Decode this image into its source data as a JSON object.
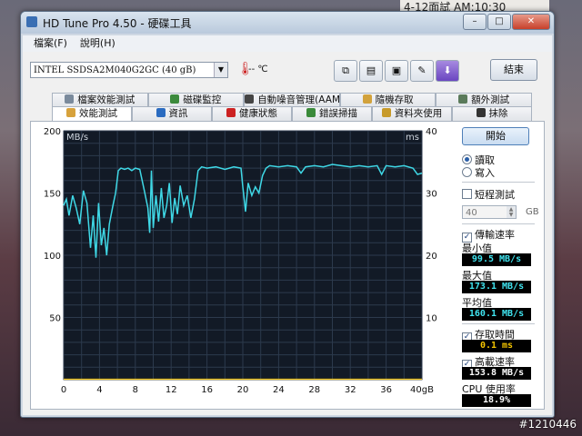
{
  "desktop": {
    "note": "4-12面試 AM:10:30",
    "tag": "#1210446"
  },
  "window": {
    "title": "HD Tune Pro 4.50 - 硬碟工具",
    "min": "–",
    "max": "□",
    "close": "✕"
  },
  "menu": {
    "file": "檔案(F)",
    "help": "說明(H)"
  },
  "toolbar": {
    "drive": "INTEL SSDSA2M040G2GC    (40 gB)",
    "temperature": "-- ℃",
    "exit_label": "結束"
  },
  "tabs": {
    "top": [
      "檔案效能測試",
      "磁碟監控",
      "自動噪音管理(AAM)",
      "隨機存取",
      "額外測試"
    ],
    "bottom": [
      "效能測試",
      "資訊",
      "健康狀態",
      "錯誤掃描",
      "資料夾使用",
      "抹除"
    ],
    "active": "效能測試"
  },
  "controls": {
    "start_label": "開始",
    "read_label": "讀取",
    "write_label": "寫入",
    "short_test_label": "短程測試",
    "short_test_value": "40",
    "short_test_unit": "GB",
    "transfer_label": "傳輸速率",
    "min_label": "最小值",
    "min_value": "99.5 MB/s",
    "max_label": "最大值",
    "max_value": "173.1 MB/s",
    "avg_label": "平均值",
    "avg_value": "160.1 MB/s",
    "access_label": "存取時間",
    "access_value": "0.1 ms",
    "burst_label": "高載速率",
    "burst_value": "153.8 MB/s",
    "cpu_label": "CPU 使用率",
    "cpu_value": "18.9%"
  },
  "chart_data": {
    "type": "line",
    "ylabel": "MB/s",
    "y2label": "ms",
    "xlabel": "gB",
    "xlim": [
      0,
      40
    ],
    "ylim": [
      0,
      200
    ],
    "y2lim": [
      0,
      40
    ],
    "x_ticks": [
      "0",
      "4",
      "8",
      "12",
      "16",
      "20",
      "24",
      "28",
      "32",
      "36",
      "40gB"
    ],
    "y_ticks": [
      "200",
      "150",
      "100",
      "50"
    ],
    "y2_ticks": [
      "40",
      "30",
      "20",
      "10"
    ],
    "series": [
      {
        "color": "#3fd8e6",
        "x": [
          0,
          0.3,
          0.6,
          1,
          1.4,
          1.8,
          2.2,
          2.6,
          3,
          3.3,
          3.6,
          3.9,
          4.2,
          4.5,
          4.8,
          5.1,
          5.5,
          5.8,
          6.1,
          6.4,
          6.8,
          7.2,
          7.6,
          8,
          8.5,
          9,
          9.4,
          9.6,
          9.8,
          10,
          10.3,
          10.6,
          10.9,
          11.2,
          11.5,
          11.8,
          12.1,
          12.4,
          12.7,
          13,
          13.4,
          13.8,
          14.2,
          14.6,
          15,
          15.4,
          16,
          17,
          18,
          19,
          19.8,
          20,
          20.3,
          20.6,
          21,
          21.4,
          21.8,
          22.2,
          22.6,
          23,
          24,
          25,
          26,
          26.5,
          27,
          28,
          29,
          30,
          31,
          32,
          33,
          34,
          35,
          35.5,
          36,
          37,
          38,
          39,
          39.5,
          40
        ],
        "y": [
          140,
          145,
          132,
          148,
          138,
          125,
          152,
          142,
          106,
          132,
          98,
          142,
          108,
          122,
          100,
          125,
          140,
          150,
          168,
          170,
          169,
          170,
          168,
          170,
          169,
          152,
          138,
          118,
          168,
          122,
          148,
          127,
          154,
          130,
          140,
          158,
          126,
          146,
          133,
          156,
          140,
          148,
          130,
          145,
          168,
          171,
          170,
          171,
          169,
          171,
          170,
          155,
          135,
          158,
          148,
          155,
          150,
          164,
          170,
          172,
          171,
          172,
          171,
          166,
          171,
          172,
          171,
          173,
          172,
          171,
          172,
          171,
          172,
          165,
          172,
          171,
          172,
          170,
          165,
          166
        ]
      },
      {
        "color": "#f2c61f",
        "x": [
          0,
          40
        ],
        "y": [
          0.4,
          0.4
        ]
      }
    ]
  }
}
